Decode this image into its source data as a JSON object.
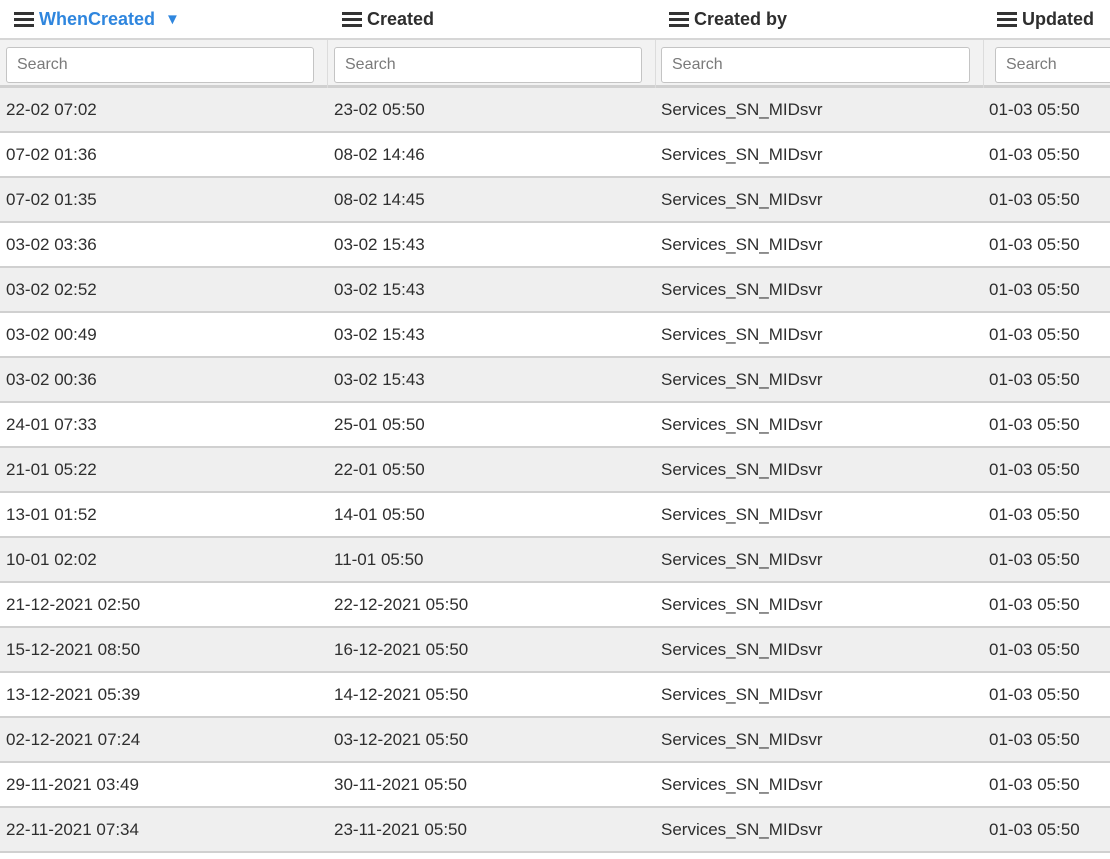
{
  "columns": [
    {
      "key": "when_created",
      "label": "WhenCreated",
      "sorted": true,
      "sort_direction": "descending"
    },
    {
      "key": "created",
      "label": "Created",
      "sorted": false
    },
    {
      "key": "created_by",
      "label": "Created by",
      "sorted": false
    },
    {
      "key": "updated",
      "label": "Updated",
      "sorted": false
    }
  ],
  "search": {
    "placeholder": "Search"
  },
  "colors": {
    "sort_accent": "#2f86de",
    "row_alt": "#efefef"
  },
  "rows": [
    [
      "22-02 07:02",
      "23-02 05:50",
      "Services_SN_MIDsvr",
      "01-03 05:50"
    ],
    [
      "07-02 01:36",
      "08-02 14:46",
      "Services_SN_MIDsvr",
      "01-03 05:50"
    ],
    [
      "07-02 01:35",
      "08-02 14:45",
      "Services_SN_MIDsvr",
      "01-03 05:50"
    ],
    [
      "03-02 03:36",
      "03-02 15:43",
      "Services_SN_MIDsvr",
      "01-03 05:50"
    ],
    [
      "03-02 02:52",
      "03-02 15:43",
      "Services_SN_MIDsvr",
      "01-03 05:50"
    ],
    [
      "03-02 00:49",
      "03-02 15:43",
      "Services_SN_MIDsvr",
      "01-03 05:50"
    ],
    [
      "03-02 00:36",
      "03-02 15:43",
      "Services_SN_MIDsvr",
      "01-03 05:50"
    ],
    [
      "24-01 07:33",
      "25-01 05:50",
      "Services_SN_MIDsvr",
      "01-03 05:50"
    ],
    [
      "21-01 05:22",
      "22-01 05:50",
      "Services_SN_MIDsvr",
      "01-03 05:50"
    ],
    [
      "13-01 01:52",
      "14-01 05:50",
      "Services_SN_MIDsvr",
      "01-03 05:50"
    ],
    [
      "10-01 02:02",
      "11-01 05:50",
      "Services_SN_MIDsvr",
      "01-03 05:50"
    ],
    [
      "21-12-2021 02:50",
      "22-12-2021 05:50",
      "Services_SN_MIDsvr",
      "01-03 05:50"
    ],
    [
      "15-12-2021 08:50",
      "16-12-2021 05:50",
      "Services_SN_MIDsvr",
      "01-03 05:50"
    ],
    [
      "13-12-2021 05:39",
      "14-12-2021 05:50",
      "Services_SN_MIDsvr",
      "01-03 05:50"
    ],
    [
      "02-12-2021 07:24",
      "03-12-2021 05:50",
      "Services_SN_MIDsvr",
      "01-03 05:50"
    ],
    [
      "29-11-2021 03:49",
      "30-11-2021 05:50",
      "Services_SN_MIDsvr",
      "01-03 05:50"
    ],
    [
      "22-11-2021 07:34",
      "23-11-2021 05:50",
      "Services_SN_MIDsvr",
      "01-03 05:50"
    ]
  ]
}
